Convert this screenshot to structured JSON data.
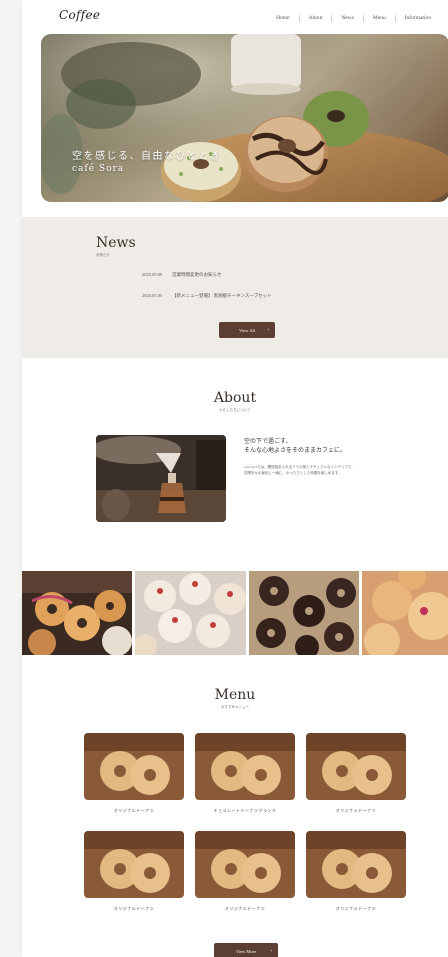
{
  "header": {
    "logo": "Coffee",
    "nav": [
      "Home",
      "About",
      "News",
      "Menu",
      "Information"
    ]
  },
  "hero": {
    "title": "空を感じる、自由なひととき",
    "subtitle": "café Sora"
  },
  "news": {
    "title": "News",
    "subtitle": "お知らせ",
    "items": [
      {
        "date": "2025.05.09",
        "text": "営業時間変更のお知らせ"
      },
      {
        "date": "2025.05.05",
        "text": "【新メニュー登場】 黒胡椒チーキンスープセット"
      }
    ],
    "button": "View All",
    "arrow": "›"
  },
  "about": {
    "title": "About",
    "subtitle": "わたしたちについて",
    "catch1": "空の下で過ごす、",
    "catch2": "そんな心地よさをそのままカフェに。",
    "body1": "café Soraでは、開放感あふれるテラス席とナチュラルなインテリアで、",
    "body2": "四季折々の景色と一緒に、ゆったりとした時間を楽しめます。"
  },
  "menu": {
    "title": "Menu",
    "subtitle": "おすすめメニュー",
    "items": [
      {
        "label": "オリジナルドーナツ"
      },
      {
        "label": "チョコレートドーナツクランチ"
      },
      {
        "label": "オリジナルドーナツ"
      },
      {
        "label": "オリジナルドーナツ"
      },
      {
        "label": "オリジナルドーナツ"
      },
      {
        "label": "オリジナルドーナツ"
      }
    ],
    "button": "View More",
    "arrow": "›"
  },
  "colors": {
    "accent": "#5c3e33",
    "news_bg": "#efebe6",
    "text": "#3a2e28"
  }
}
